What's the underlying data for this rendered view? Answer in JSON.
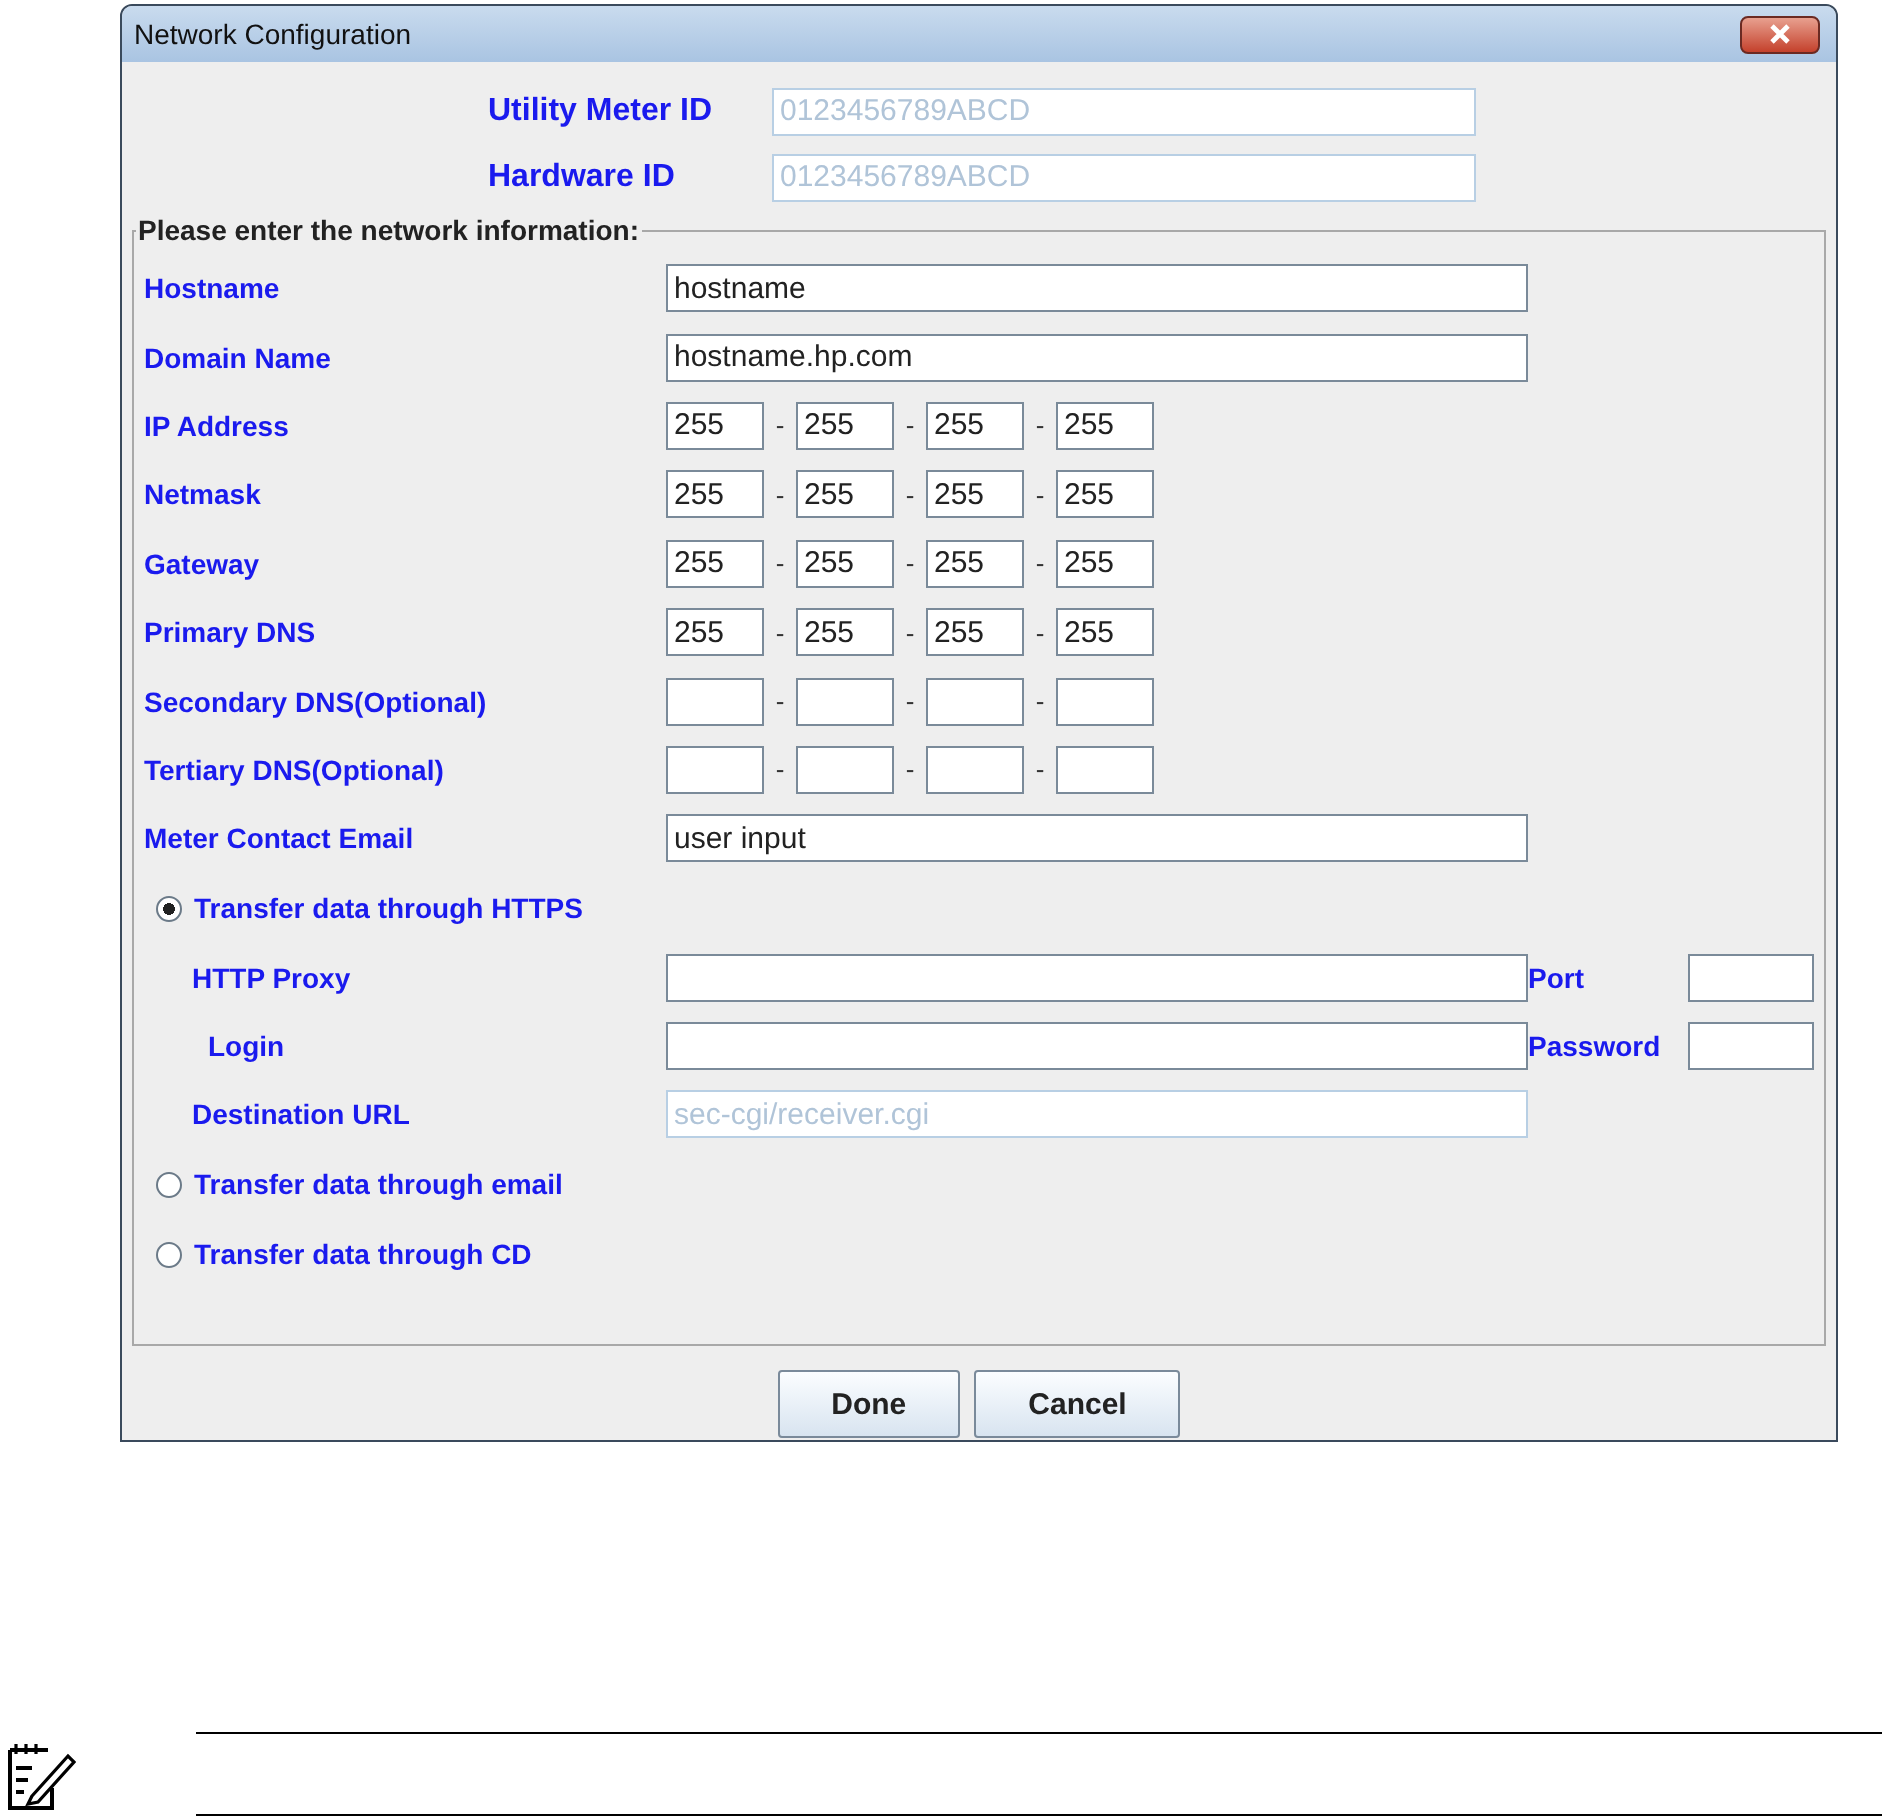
{
  "window": {
    "title": "Network Configuration"
  },
  "id_fields": [
    {
      "label": "Utility Meter ID",
      "value": "0123456789ABCD",
      "disabled": true
    },
    {
      "label": "Hardware ID",
      "value": "0123456789ABCD",
      "disabled": true
    }
  ],
  "group": {
    "title": "Please enter the network information:"
  },
  "fields": [
    {
      "kind": "text",
      "label": "Hostname",
      "value": "hostname"
    },
    {
      "kind": "text",
      "label": "Domain Name",
      "value": "hostname.hp.com"
    },
    {
      "kind": "ip",
      "label": "IP Address",
      "octets": [
        "255",
        "255",
        "255",
        "255"
      ],
      "separators": [
        "-",
        "-",
        "-"
      ]
    },
    {
      "kind": "ip",
      "label": "Netmask",
      "octets": [
        "255",
        "255",
        "255",
        "255"
      ],
      "separators": [
        "-",
        "-",
        "-"
      ]
    },
    {
      "kind": "ip",
      "label": "Gateway",
      "octets": [
        "255",
        "255",
        "255",
        "255"
      ],
      "separators": [
        "-",
        "-",
        "-"
      ]
    },
    {
      "kind": "ip",
      "label": "Primary DNS",
      "octets": [
        "255",
        "255",
        "255",
        "255"
      ],
      "separators": [
        "-",
        "-",
        "-"
      ]
    },
    {
      "kind": "ip",
      "label": "Secondary DNS(Optional)",
      "separators": [
        "-",
        "-",
        "-"
      ]
    },
    {
      "kind": "ip",
      "label": "Tertiary DNS(Optional)",
      "separators": [
        "-",
        "-",
        "-"
      ]
    },
    {
      "kind": "text",
      "label": "Meter Contact Email",
      "value": "user input"
    }
  ],
  "transfer_options": [
    {
      "label": "Transfer data through HTTPS",
      "selected": true,
      "fields": [
        {
          "label": "HTTP Proxy",
          "side_label": "Port",
          "disabled": false
        },
        {
          "label": "Login",
          "side_label": "Password",
          "indent": true,
          "disabled": false
        },
        {
          "label": "Destination URL",
          "value": "sec-cgi/receiver.cgi",
          "disabled": true
        }
      ]
    },
    {
      "label": "Transfer data through email",
      "selected": false
    },
    {
      "label": "Transfer data through CD",
      "selected": false
    }
  ],
  "buttons": [
    "Done",
    "Cancel"
  ]
}
